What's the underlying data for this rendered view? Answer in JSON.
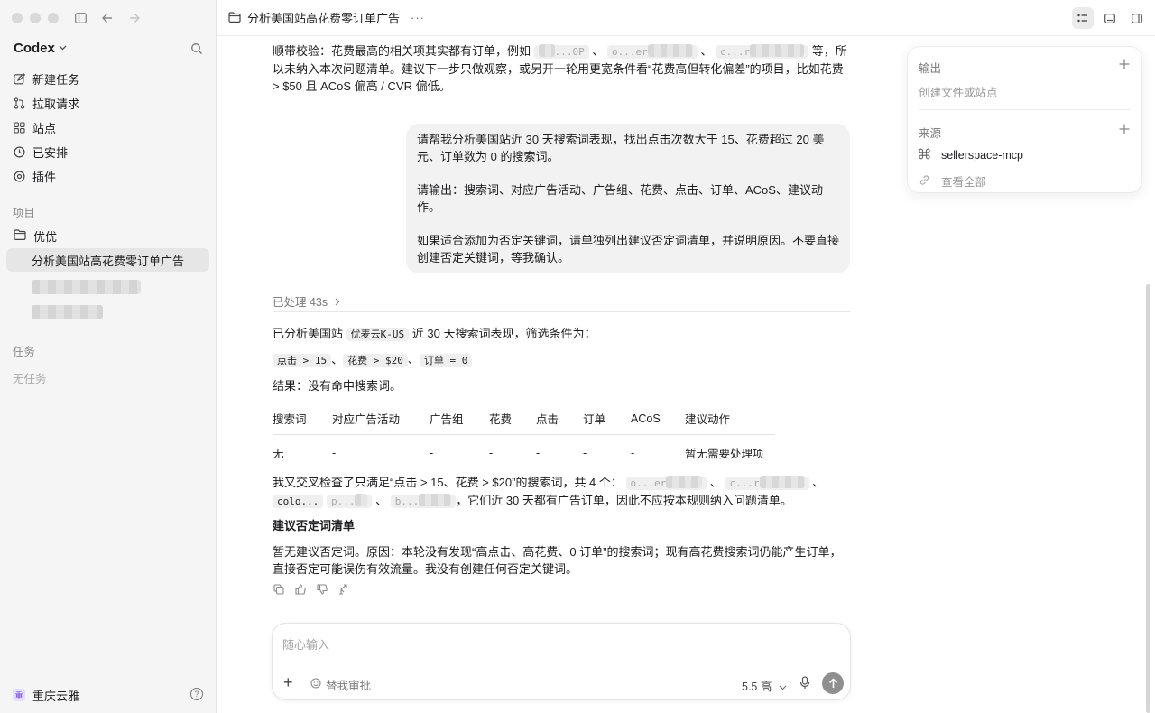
{
  "sidebar": {
    "brand": "Codex",
    "nav": [
      {
        "label": "新建任务",
        "icon": "compose-icon"
      },
      {
        "label": "拉取请求",
        "icon": "pull-request-icon"
      },
      {
        "label": "站点",
        "icon": "grid-icon"
      },
      {
        "label": "已安排",
        "icon": "clock-icon"
      },
      {
        "label": "插件",
        "icon": "plugin-icon"
      }
    ],
    "projects_label": "项目",
    "project_name": "优优",
    "active_thread": "分析美国站高花费零订单广告",
    "tasks_label": "任务",
    "no_tasks": "无任务",
    "org_badge": "重",
    "org_name": "重庆云雅",
    "help": "?"
  },
  "topbar": {
    "title": "分析美国站高花费零订单广告",
    "more": "···"
  },
  "chat": {
    "prev_tail_1": "顺带校验：花费最高的相关项其实都有订单，例如",
    "prev_redact_1a": "...0P",
    "prev_redact_1b": "o...er",
    "prev_redact_1c": "c...r",
    "prev_tail_2": "等，所以未纳入本次问题清单。建议下一步只做观察，或另开一轮用更宽条件看“花费高但转化偏差”的项目，比如花费 > $50 且 ACoS 偏高 / CVR 偏低。",
    "user_msg_1": "请帮我分析美国站近 30 天搜索词表现，找出点击次数大于 15、花费超过 20 美元、订单数为 0 的搜索词。",
    "user_msg_2": "请输出：搜索词、对应广告活动、广告组、花费、点击、订单、ACoS、建议动作。",
    "user_msg_3": "如果适合添加为否定关键词，请单独列出建议否定词清单，并说明原因。不要直接创建否定关键词，等我确认。",
    "processed": "已处理 43s",
    "result_intro_a": "已分析美国站",
    "result_store": "优麦云K-US",
    "result_intro_b": "近 30 天搜索词表现，筛选条件为：",
    "cond_1": "点击 > 15",
    "cond_2": "花费 > $20",
    "cond_3": "订单 = 0",
    "cond_sep": "、",
    "result_line": "结果：没有命中搜索词。",
    "table": {
      "headers": [
        "搜索词",
        "对应广告活动",
        "广告组",
        "花费",
        "点击",
        "订单",
        "ACoS",
        "建议动作"
      ],
      "row": [
        "无",
        "-",
        "-",
        "-",
        "-",
        "-",
        "-",
        "暂无需要处理项"
      ]
    },
    "cross_a": "我又交叉检查了只满足“点击 > 15、花费 > $20”的搜索词，共 4 个：",
    "cross_r1": "o...er",
    "cross_r2": "c...r",
    "cross_r3": "colo...",
    "cross_r4": "p...",
    "cross_r5": "b...",
    "cross_b": "，它们近 30 天都有广告订单，因此不应按本规则纳入问题清单。",
    "neg_title": "建议否定词清单",
    "neg_body": "暂无建议否定词。原因：本轮没有发现“高点击、高花费、0 订单”的搜索词；现有高花费搜索词仍能产生订单，直接否定可能误伤有效流量。我没有创建任何否定关键词。"
  },
  "composer": {
    "placeholder": "随心输入",
    "add": "+",
    "approval": "替我审批",
    "model": "5.5 高"
  },
  "panel": {
    "output_label": "输出",
    "output_hint": "创建文件或站点",
    "source_label": "来源",
    "source_item": "sellerspace-mcp",
    "view_all": "查看全部"
  }
}
